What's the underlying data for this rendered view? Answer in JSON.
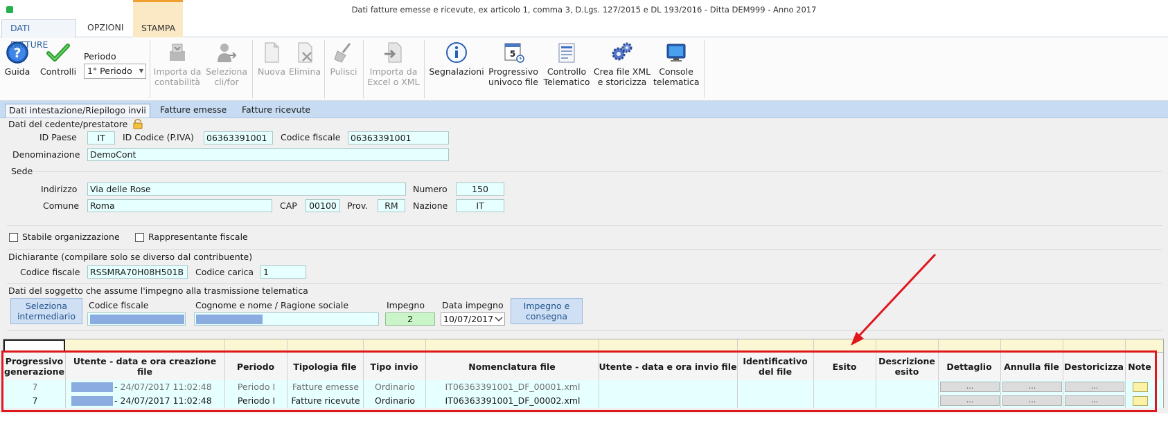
{
  "window": {
    "title": "Dati fatture emesse e ricevute, ex articolo 1, comma 3, D.Lgs. 127/2015 e DL 193/2016 - Ditta DEM999 - Anno 2017"
  },
  "ribbon_tabs": [
    "DATI FATTURE",
    "OPZIONI",
    "STAMPA"
  ],
  "ribbon": {
    "guida": "Guida",
    "controlli": "Controlli",
    "periodo_label": "Periodo",
    "periodo_value": "1° Periodo",
    "importa_contabilita": [
      "Importa da",
      "contabilità"
    ],
    "seleziona_clifor": [
      "Seleziona",
      "cli/for"
    ],
    "nuova": "Nuova",
    "elimina": "Elimina",
    "pulisci": "Pulisci",
    "importa_excel": [
      "Importa da",
      "Excel o XML"
    ],
    "segnalazioni": "Segnalazioni",
    "progressivo": [
      "Progressivo",
      "univoco file"
    ],
    "controllo_telematico": [
      "Controllo",
      "Telematico"
    ],
    "crea_xml": [
      "Crea file XML",
      "e storicizza"
    ],
    "console": [
      "Console",
      "telematica"
    ]
  },
  "subtabs": [
    "Dati intestazione/Riepilogo invii",
    "Fatture emesse",
    "Fatture ricevute"
  ],
  "cedente": {
    "section_title": "Dati del cedente/prestatore",
    "id_paese_label": "ID Paese",
    "id_paese": "IT",
    "id_codice_label": "ID Codice (P.IVA)",
    "id_codice": "06363391001",
    "codice_fiscale_label": "Codice fiscale",
    "codice_fiscale": "06363391001",
    "denominazione_label": "Denominazione",
    "denominazione": "DemoCont"
  },
  "sede": {
    "section_title": "Sede",
    "indirizzo_label": "Indirizzo",
    "indirizzo": "Via delle Rose",
    "numero_label": "Numero",
    "numero": "150",
    "comune_label": "Comune",
    "comune": "Roma",
    "cap_label": "CAP",
    "cap": "00100",
    "prov_label": "Prov.",
    "prov": "RM",
    "nazione_label": "Nazione",
    "nazione": "IT"
  },
  "checkboxes": {
    "stabile": "Stabile organizzazione",
    "rappresentante": "Rappresentante fiscale"
  },
  "dichiarante": {
    "section_title": "Dichiarante (compilare solo se diverso dal contribuente)",
    "codice_fiscale_label": "Codice fiscale",
    "codice_fiscale": "RSSMRA70H08H501B",
    "codice_carica_label": "Codice carica",
    "codice_carica": "1"
  },
  "impegno": {
    "section_title": "Dati del soggetto che assume l'impegno alla trasmissione telematica",
    "seleziona_btn": [
      "Seleziona",
      "intermediario"
    ],
    "codice_fiscale_label": "Codice fiscale",
    "cognome_label": "Cognome e nome / Ragione sociale",
    "impegno_label": "Impegno",
    "impegno_value": "2",
    "data_label": "Data impegno",
    "data_value": "10/07/2017",
    "impegno_consegna_btn": [
      "Impegno e",
      "consegna"
    ]
  },
  "table": {
    "headers": [
      [
        "Progressivo",
        "generazione"
      ],
      [
        "Utente - data e ora creazione file"
      ],
      [
        "Periodo"
      ],
      [
        "Tipologia file"
      ],
      [
        "Tipo invio"
      ],
      [
        "Nomenclatura file"
      ],
      [
        "Utente - data e ora invio file"
      ],
      [
        "Identificativo",
        "del file"
      ],
      [
        "Esito"
      ],
      [
        "Descrizione",
        "esito"
      ],
      [
        "Dettaglio"
      ],
      [
        "Annulla file"
      ],
      [
        "Destoricizza"
      ],
      [
        "Note"
      ]
    ],
    "rows": [
      {
        "progressivo": "7",
        "utente_creazione": "- 24/07/2017 11:02:48",
        "periodo": "Periodo I",
        "tipologia": "Fatture emesse",
        "tipo_invio": "Ordinario",
        "nomenclatura": "IT06363391001_DF_00001.xml",
        "dettaglio": "...",
        "annulla": "...",
        "destoricizza": "..."
      },
      {
        "progressivo": "7",
        "utente_creazione": "- 24/07/2017 11:02:48",
        "periodo": "Periodo I",
        "tipologia": "Fatture ricevute",
        "tipo_invio": "Ordinario",
        "nomenclatura": "IT06363391001_DF_00002.xml",
        "dettaglio": "...",
        "annulla": "...",
        "destoricizza": "..."
      }
    ]
  },
  "colors": {
    "highlight": "#e0161d",
    "field_bg": "#e6ffff",
    "subtab_bar": "#c7dcf3",
    "stampa_tab": "#fbe8c4"
  }
}
